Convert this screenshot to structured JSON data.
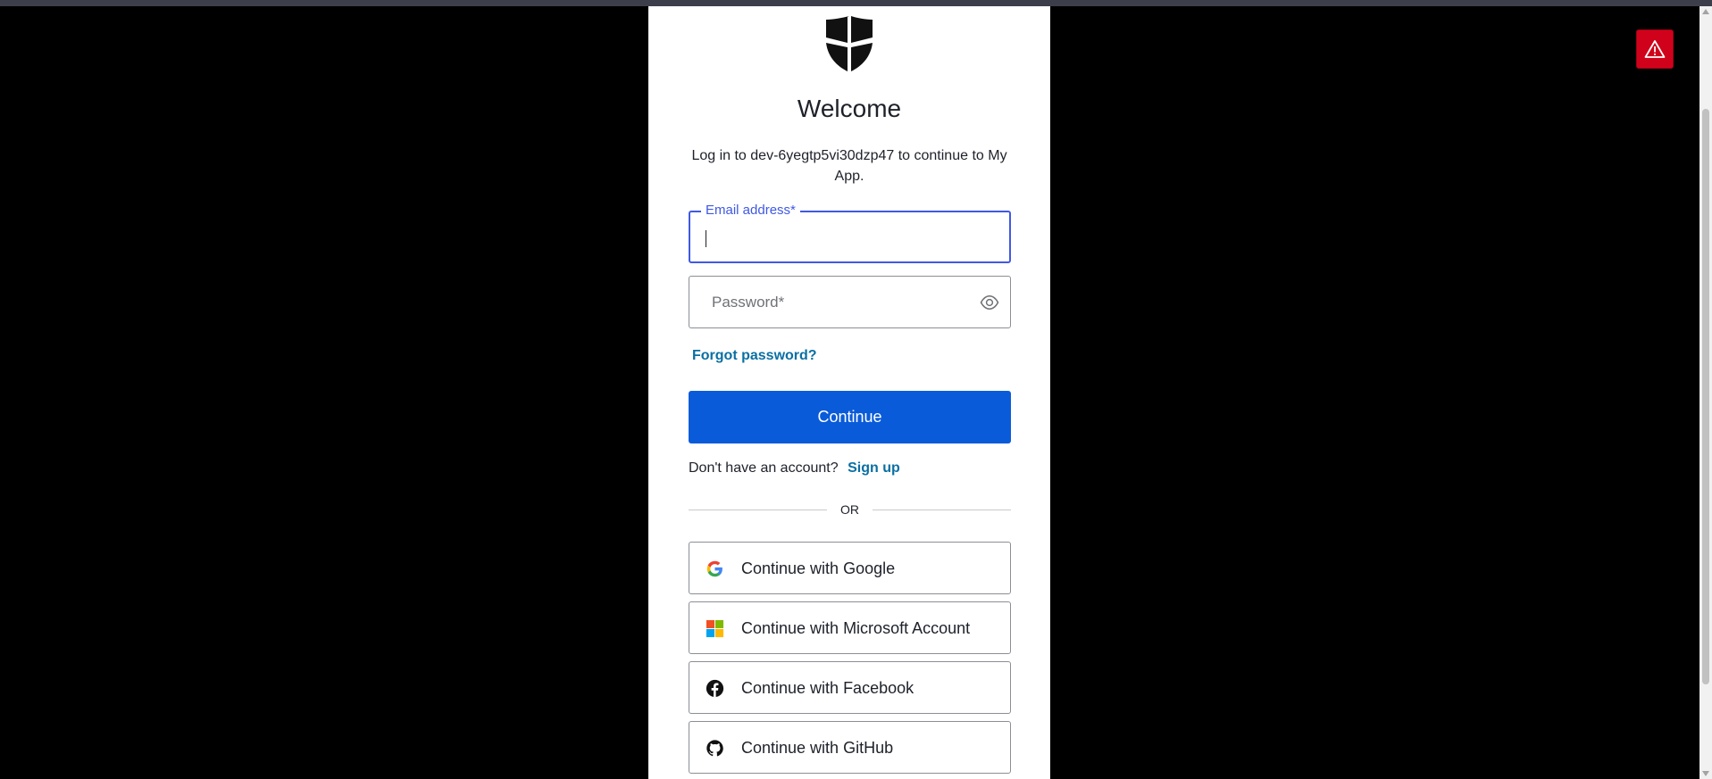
{
  "brand": {
    "primary_color": "#0a5bd9",
    "link_color": "#0a6fa3",
    "focus_color": "#3f59e4",
    "logo_icon": "shield-logo-icon"
  },
  "warning": {
    "icon": "warning-triangle-icon",
    "color": "#d0021b"
  },
  "login": {
    "title": "Welcome",
    "subtitle": "Log in to dev-6yegtp5vi30dzp47 to continue to My App.",
    "email_label": "Email address*",
    "email_value": "",
    "password_placeholder": "Password*",
    "forgot_password": "Forgot password?",
    "continue_label": "Continue",
    "no_account_text": "Don't have an account?",
    "signup_label": "Sign up",
    "or_text": "OR"
  },
  "social": [
    {
      "label": "Continue with Google",
      "icon": "google-icon"
    },
    {
      "label": "Continue with Microsoft Account",
      "icon": "microsoft-icon"
    },
    {
      "label": "Continue with Facebook",
      "icon": "facebook-icon"
    },
    {
      "label": "Continue with GitHub",
      "icon": "github-icon"
    }
  ]
}
